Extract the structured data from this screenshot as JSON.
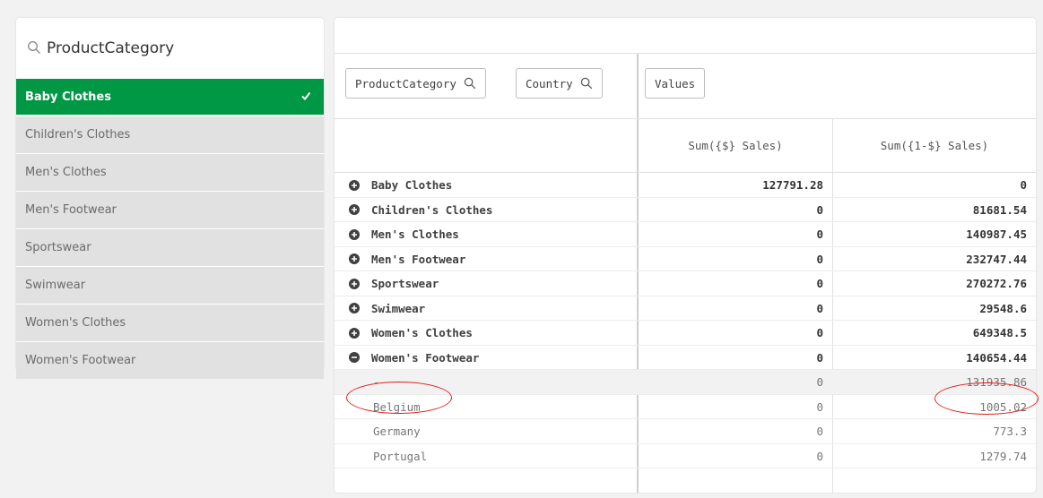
{
  "filter": {
    "title": "ProductCategory",
    "items": [
      {
        "label": "Baby Clothes",
        "selected": true
      },
      {
        "label": "Children's Clothes",
        "selected": false
      },
      {
        "label": "Men's Clothes",
        "selected": false
      },
      {
        "label": "Men's Footwear",
        "selected": false
      },
      {
        "label": "Sportswear",
        "selected": false
      },
      {
        "label": "Swimwear",
        "selected": false
      },
      {
        "label": "Women's Clothes",
        "selected": false
      },
      {
        "label": "Women's Footwear",
        "selected": false
      }
    ]
  },
  "pivot": {
    "dimensions": [
      "ProductCategory",
      "Country"
    ],
    "values_chip": "Values",
    "columns": [
      "Sum({$} Sales)",
      "Sum({1-$} Sales)"
    ],
    "rows": [
      {
        "label": "Baby Clothes",
        "v1": "127791.28",
        "v2": "0",
        "expanded": false
      },
      {
        "label": "Children's Clothes",
        "v1": "0",
        "v2": "81681.54",
        "expanded": false
      },
      {
        "label": "Men's Clothes",
        "v1": "0",
        "v2": "140987.45",
        "expanded": false
      },
      {
        "label": "Men's Footwear",
        "v1": "0",
        "v2": "232747.44",
        "expanded": false
      },
      {
        "label": "Sportswear",
        "v1": "0",
        "v2": "270272.76",
        "expanded": false
      },
      {
        "label": "Swimwear",
        "v1": "0",
        "v2": "29548.6",
        "expanded": false
      },
      {
        "label": "Women's Clothes",
        "v1": "0",
        "v2": "649348.5",
        "expanded": false
      },
      {
        "label": "Women's Footwear",
        "v1": "0",
        "v2": "140654.44",
        "expanded": true
      }
    ],
    "subrows": [
      {
        "label": "-",
        "v1": "0",
        "v2": "131935.86"
      },
      {
        "label": "Belgium",
        "v1": "0",
        "v2": "1005.02"
      },
      {
        "label": "Germany",
        "v1": "0",
        "v2": "773.3"
      },
      {
        "label": "Portugal",
        "v1": "0",
        "v2": "1279.74"
      }
    ]
  },
  "colors": {
    "selected_green": "#009845",
    "annotation_red": "#e21e1e"
  },
  "icons": {
    "search": "search-icon",
    "check": "check-icon",
    "expand": "plus-circle-icon",
    "collapse": "minus-circle-icon"
  }
}
